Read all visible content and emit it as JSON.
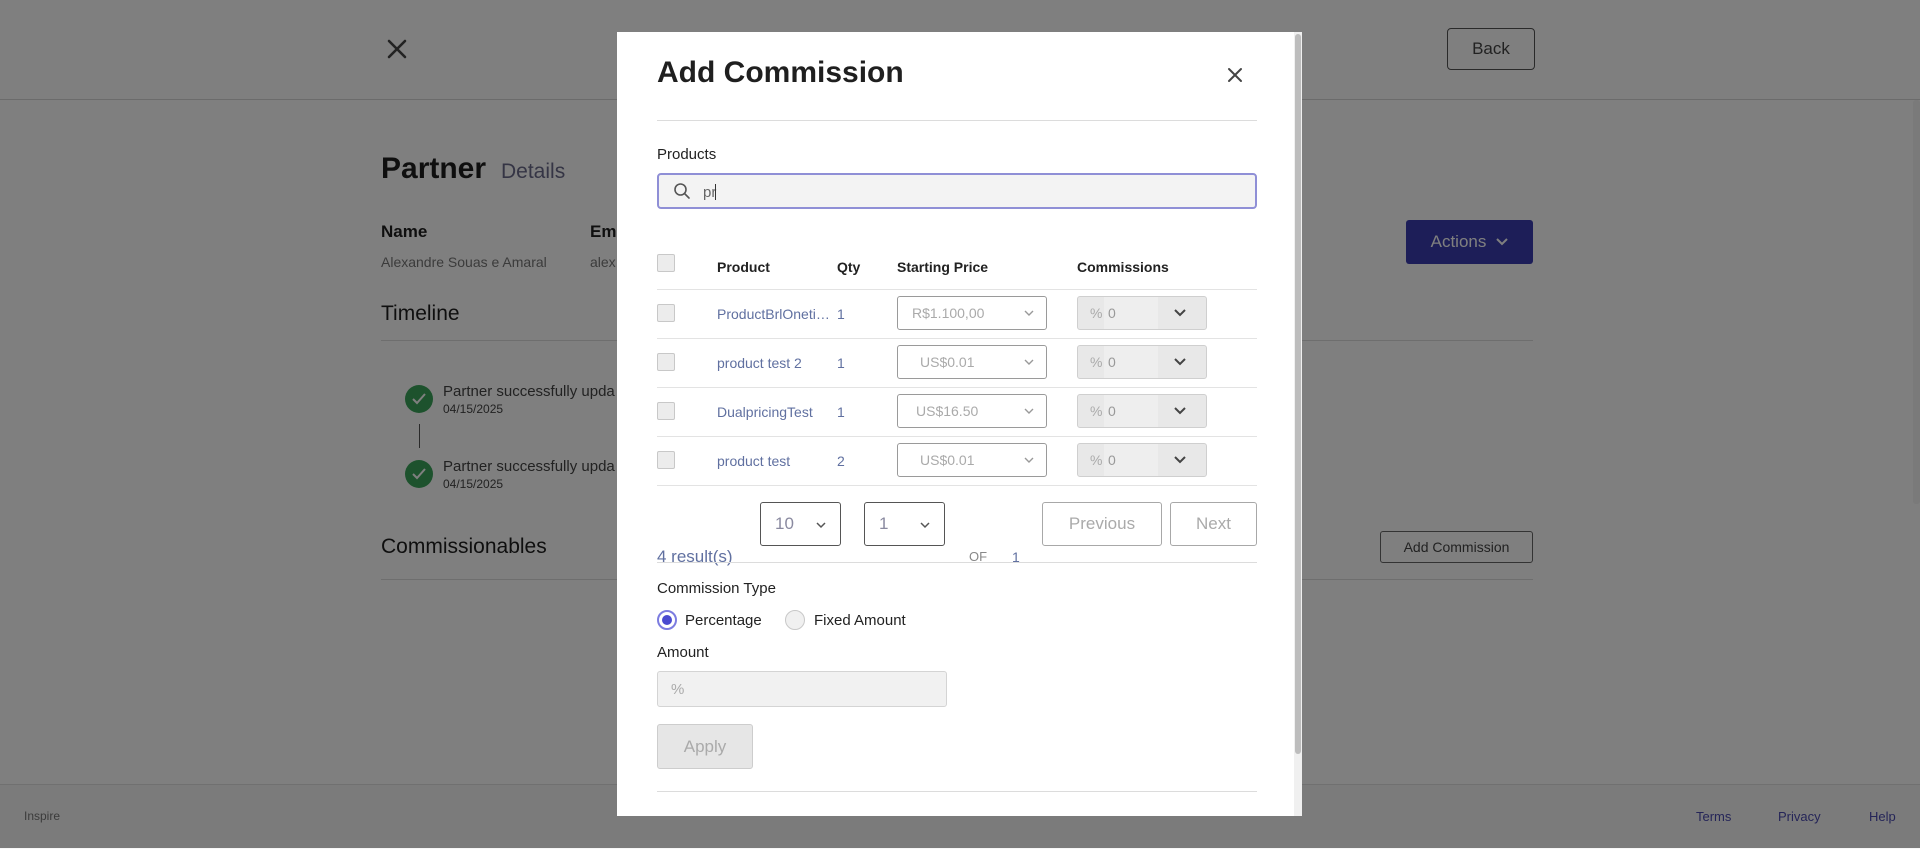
{
  "background": {
    "back_label": "Back",
    "title": "Partner",
    "subtitle": "Details",
    "name_label": "Name",
    "name_value": "Alexandre Souas e Amaral",
    "email_label": "Ema",
    "email_value": "alex",
    "actions_label": "Actions",
    "timeline_title": "Timeline",
    "timeline": [
      {
        "text": "Partner successfully upda",
        "date": "04/15/2025"
      },
      {
        "text": "Partner successfully upda",
        "date": "04/15/2025"
      }
    ],
    "commissionables_title": "Commissionables",
    "add_commission_label": "Add Commission",
    "footer": {
      "brand": "Inspire",
      "links": [
        "Terms",
        "Privacy",
        "Help"
      ]
    }
  },
  "modal": {
    "title": "Add Commission",
    "products_label": "Products",
    "search_value": "pr",
    "table": {
      "headers": [
        "Product",
        "Qty",
        "Starting Price",
        "Commissions"
      ],
      "rows": [
        {
          "product": "ProductBrlOnetime",
          "qty": "1",
          "price": "R$1.100,00",
          "commission_prefix": "%",
          "commission": "0"
        },
        {
          "product": "product test 2",
          "qty": "1",
          "price": "US$0.01",
          "commission_prefix": "%",
          "commission": "0"
        },
        {
          "product": "DualpricingTest",
          "qty": "1",
          "price": "US$16.50",
          "commission_prefix": "%",
          "commission": "0"
        },
        {
          "product": "product test",
          "qty": "2",
          "price": "US$0.01",
          "commission_prefix": "%",
          "commission": "0"
        }
      ]
    },
    "pagination": {
      "results": "4 result(s)",
      "page_size": "10",
      "page": "1",
      "of_label": "OF",
      "total_pages": "1",
      "previous_label": "Previous",
      "next_label": "Next"
    },
    "commission_type_label": "Commission Type",
    "commission_type_options": [
      "Percentage",
      "Fixed Amount"
    ],
    "commission_type_selected": "Percentage",
    "amount_label": "Amount",
    "amount_prefix": "%",
    "amount_value": "",
    "apply_label": "Apply"
  },
  "colors": {
    "accent": "#3a3db0",
    "radio_selected": "#4a4ad0",
    "success": "#3aa55a"
  }
}
